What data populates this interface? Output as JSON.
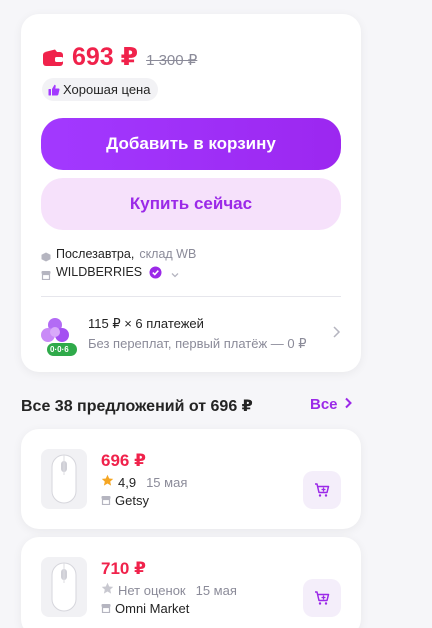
{
  "product": {
    "price": "693 ₽",
    "old_price": "1 300 ₽",
    "badge": "Хорошая цена"
  },
  "actions": {
    "add_to_cart": "Добавить в корзину",
    "buy_now": "Купить сейчас"
  },
  "delivery": {
    "when": "Послезавтра,",
    "warehouse": "склад WB",
    "seller": "WILDBERRIES"
  },
  "installment": {
    "logo_text": "0·0·6",
    "title": "115 ₽ × 6 платежей",
    "subtitle": "Без переплат, первый платёж — 0 ₽"
  },
  "offers": {
    "title": "Все 38 предложений от 696 ₽",
    "all_link": "Все",
    "items": [
      {
        "price": "696 ₽",
        "rating": "4,9",
        "date": "15 мая",
        "seller": "Getsy",
        "rated": true
      },
      {
        "price": "710 ₽",
        "rating": "Нет оценок",
        "date": "15 мая",
        "seller": "Omni Market",
        "rated": false
      }
    ]
  },
  "colors": {
    "accent": "#9b29e8",
    "price": "#f0224b",
    "muted": "#8b8b99"
  }
}
